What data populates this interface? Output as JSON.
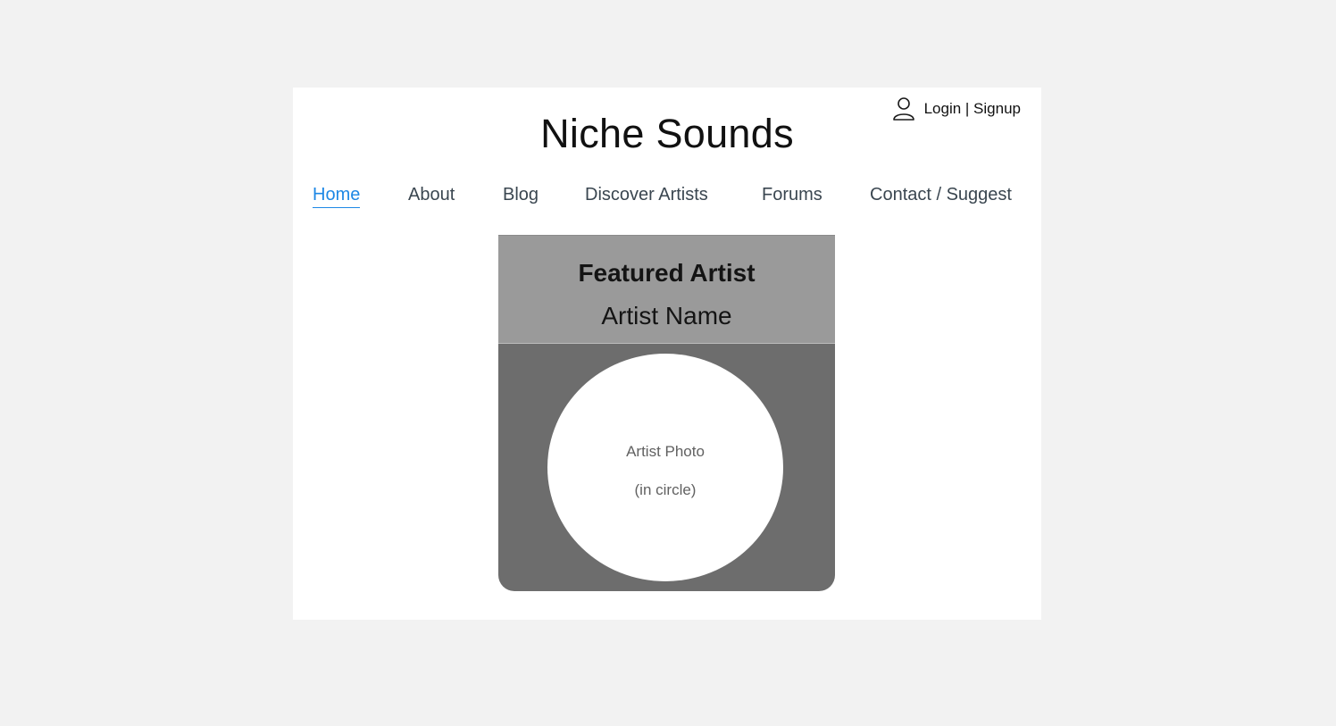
{
  "header": {
    "site_title": "Niche Sounds",
    "auth_label": "Login | Signup",
    "auth_icon": "user-icon"
  },
  "nav": {
    "items": [
      {
        "label": "Home",
        "active": true
      },
      {
        "label": "About",
        "active": false
      },
      {
        "label": "Blog",
        "active": false
      },
      {
        "label": "Discover Artists",
        "active": false
      },
      {
        "label": "Forums",
        "active": false
      },
      {
        "label": "Contact / Suggest",
        "active": false
      }
    ]
  },
  "featured": {
    "heading": "Featured Artist",
    "artist_name": "Artist Name",
    "photo_line1": "Artist Photo",
    "photo_line2": "(in circle)"
  },
  "colors": {
    "page_background": "#f2f2f2",
    "frame_background": "#ffffff",
    "accent_active_nav": "#1e88e5",
    "nav_text": "#3a4650",
    "card_header": "#9a9a9a",
    "card_body": "#6d6d6d"
  }
}
